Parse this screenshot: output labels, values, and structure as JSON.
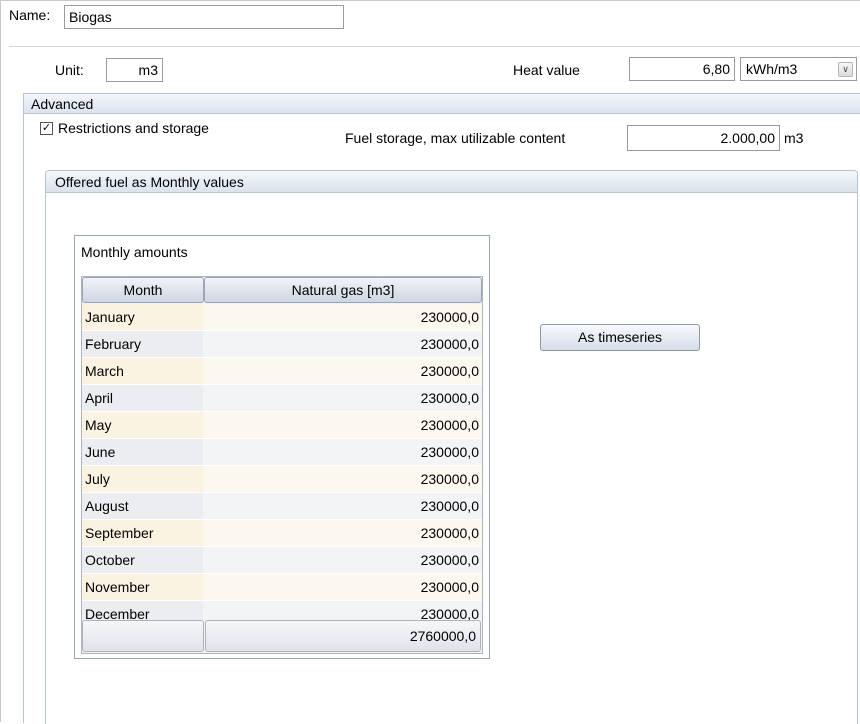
{
  "name_label": "Name:",
  "name_value": "Biogas",
  "unit_label": "Unit:",
  "unit_value": "m3",
  "heat_value_label": "Heat value",
  "heat_value": "6,80",
  "heat_unit": "kWh/m3",
  "advanced": {
    "title": "Advanced",
    "checkbox_label": "Restrictions and storage",
    "checkbox_checked": true,
    "storage_label": "Fuel storage, max utilizable content",
    "storage_value": "2.000,00",
    "storage_unit": "m3"
  },
  "offered": {
    "title": "Offered fuel as Monthly values",
    "monthly_title": "Monthly amounts",
    "columns": [
      "Month",
      "Natural gas [m3]"
    ],
    "rows": [
      {
        "month": "January",
        "value": "230000,0"
      },
      {
        "month": "February",
        "value": "230000,0"
      },
      {
        "month": "March",
        "value": "230000,0"
      },
      {
        "month": "April",
        "value": "230000,0"
      },
      {
        "month": "May",
        "value": "230000,0"
      },
      {
        "month": "June",
        "value": "230000,0"
      },
      {
        "month": "July",
        "value": "230000,0"
      },
      {
        "month": "August",
        "value": "230000,0"
      },
      {
        "month": "September",
        "value": "230000,0"
      },
      {
        "month": "October",
        "value": "230000,0"
      },
      {
        "month": "November",
        "value": "230000,0"
      },
      {
        "month": "December",
        "value": "230000,0"
      }
    ],
    "total": "2760000,0",
    "timeseries_button": "As timeseries"
  },
  "icons": {
    "check": "✓",
    "chevron": "∨"
  }
}
